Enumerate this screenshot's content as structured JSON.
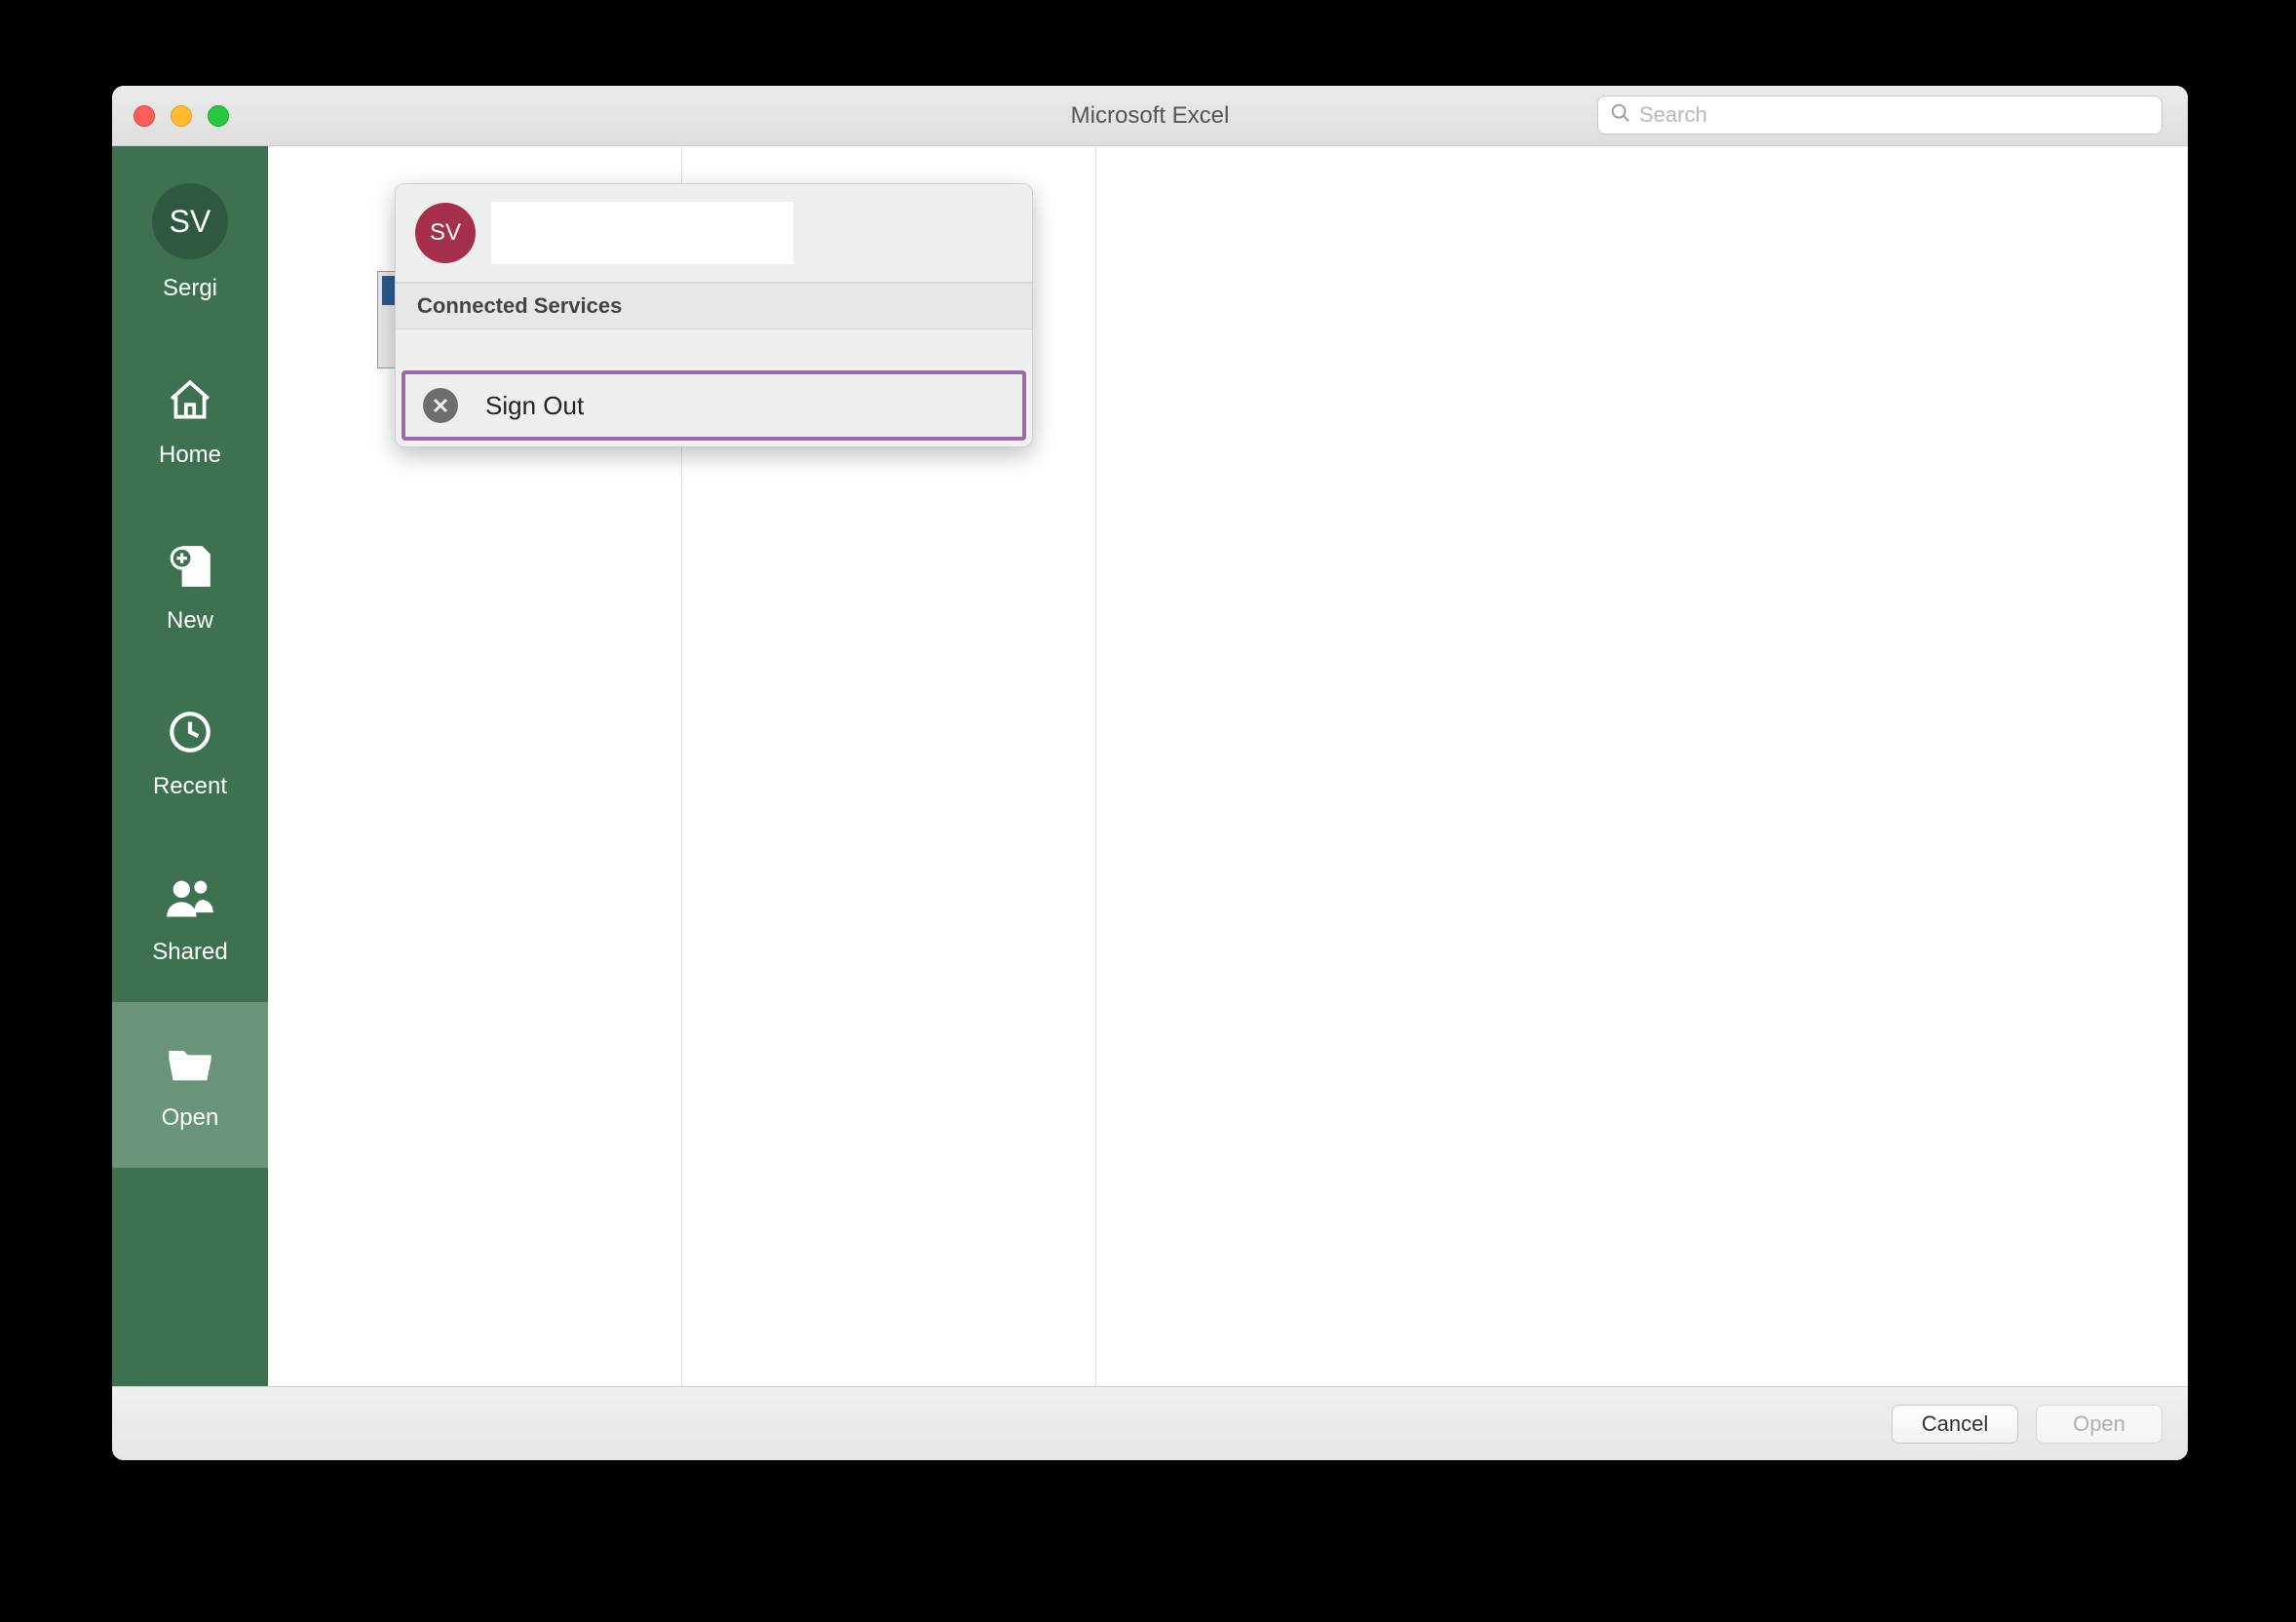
{
  "titlebar": {
    "title": "Microsoft Excel"
  },
  "search": {
    "placeholder": "Search"
  },
  "sidebar": {
    "user_initials": "SV",
    "user_name": "Sergi",
    "items": [
      {
        "label": "Home"
      },
      {
        "label": "New"
      },
      {
        "label": "Recent"
      },
      {
        "label": "Shared"
      },
      {
        "label": "Open"
      }
    ]
  },
  "popover": {
    "avatar_initials": "SV",
    "section_label": "Connected Services",
    "sign_out_label": "Sign Out"
  },
  "footer": {
    "cancel_label": "Cancel",
    "open_label": "Open"
  },
  "colors": {
    "sidebar_bg": "#3d7150",
    "sidebar_selected": "#6a9479",
    "popover_accent_border": "#9b6aa8",
    "avatar_crimson": "#a6304b"
  }
}
